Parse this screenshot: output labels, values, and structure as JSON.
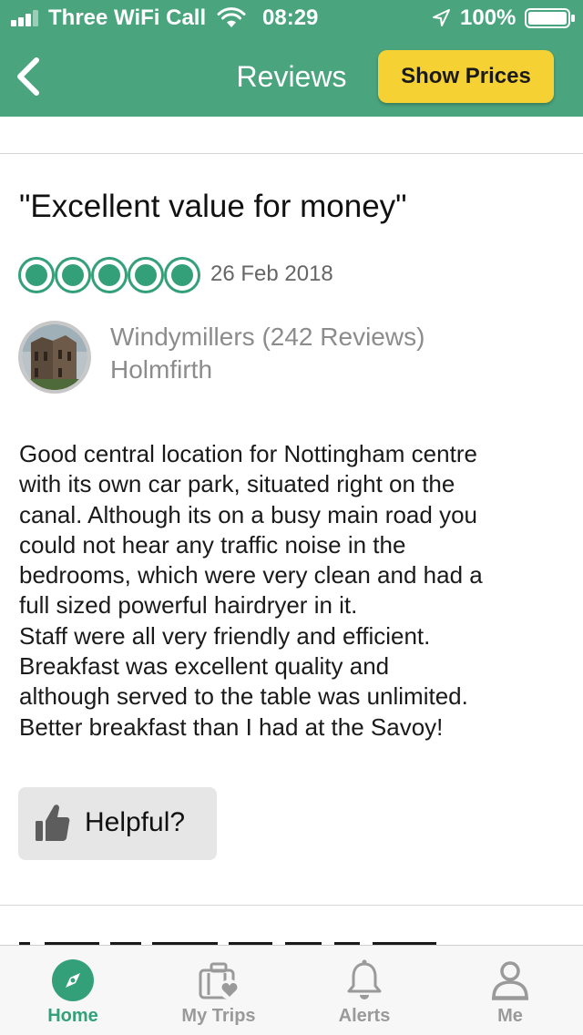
{
  "status_bar": {
    "carrier": "Three WiFi Call",
    "time": "08:29",
    "battery": "100%",
    "icons": [
      "signal-icon",
      "wifi-icon",
      "location-arrow-icon",
      "battery-icon"
    ]
  },
  "header": {
    "back_icon": "chevron-left-icon",
    "title": "Reviews",
    "show_prices_label": "Show Prices"
  },
  "review": {
    "title": "\"Excellent value for money\"",
    "rating": 5,
    "rating_max": 5,
    "date": "26 Feb 2018",
    "reviewer": {
      "name": "Windymillers (242 Reviews)",
      "location": "Holmfirth"
    },
    "body_lines": [
      "Good central location for Nottingham centre",
      "with its own car park, situated right on the",
      "canal.  Although its on a busy main road you",
      "could not hear any traffic noise in the",
      "bedrooms, which were very clean and had a",
      "full sized powerful hairdryer in it.",
      "Staff were all very friendly and efficient.",
      "Breakfast was excellent quality and",
      "although served to the table was unlimited.",
      "Better breakfast than I had at the Savoy!"
    ],
    "helpful_label": "Helpful?"
  },
  "tabs": [
    {
      "label": "Home",
      "icon": "compass-icon",
      "active": true
    },
    {
      "label": "My Trips",
      "icon": "suitcase-heart-icon",
      "active": false
    },
    {
      "label": "Alerts",
      "icon": "bell-icon",
      "active": false
    },
    {
      "label": "Me",
      "icon": "person-icon",
      "active": false
    }
  ],
  "colors": {
    "header_green": "#4aa47e",
    "accent_green": "#34a07a",
    "button_yellow": "#f5d133"
  }
}
